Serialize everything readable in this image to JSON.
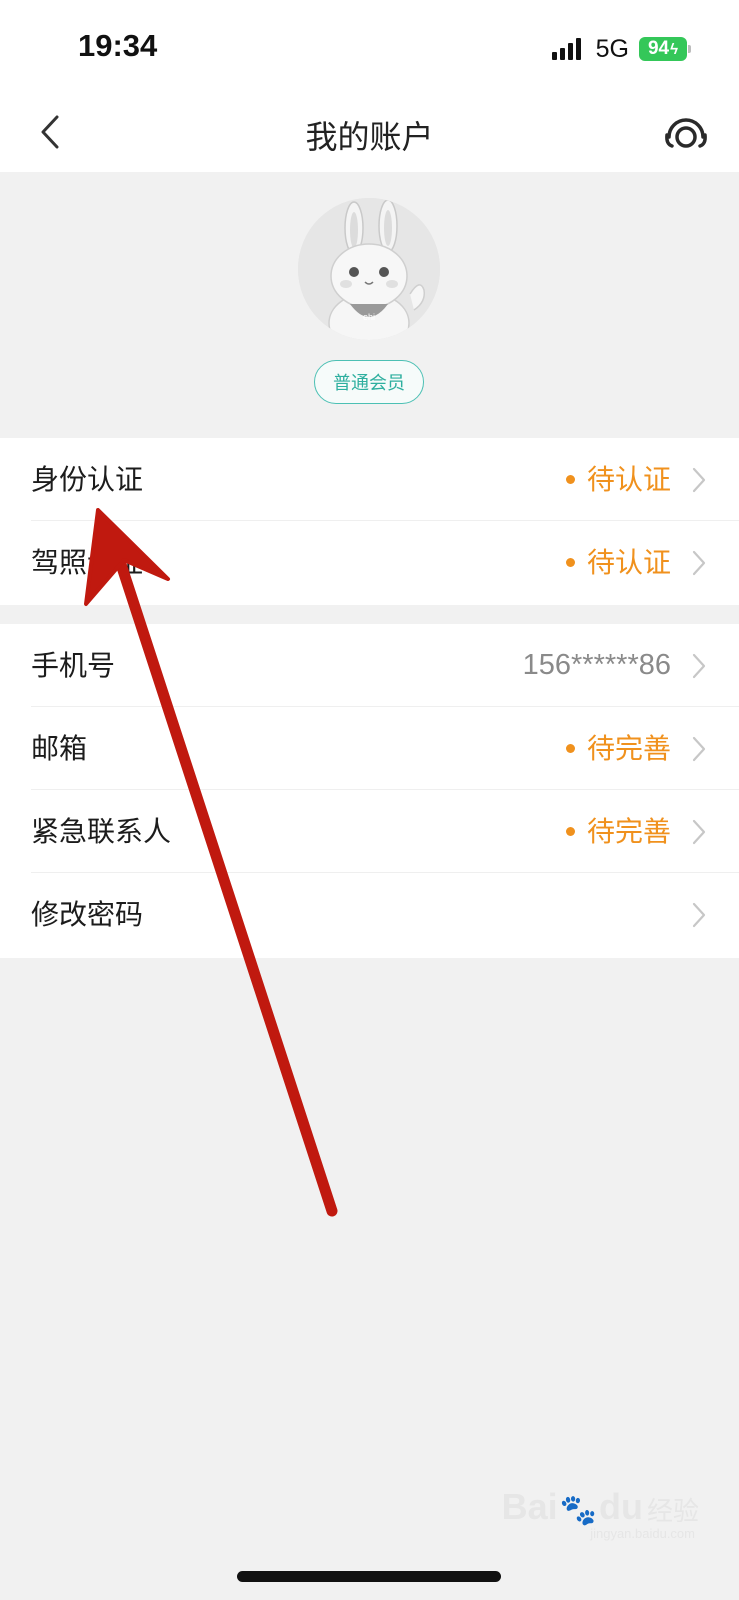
{
  "status_bar": {
    "time": "19:34",
    "network": "5G",
    "battery": "94"
  },
  "nav": {
    "title": "我的账户",
    "back_icon": "chevron-left-icon",
    "service_icon": "headset-icon"
  },
  "profile": {
    "avatar_text": "ehi",
    "member_level": "普通会员"
  },
  "verification": {
    "items": [
      {
        "label": "身份认证",
        "value": "待认证"
      },
      {
        "label": "驾照认证",
        "value": "待认证"
      }
    ]
  },
  "account": {
    "phone": {
      "label": "手机号",
      "value": "156******86"
    },
    "email": {
      "label": "邮箱",
      "value": "待完善"
    },
    "emergency": {
      "label": "紧急联系人",
      "value": "待完善"
    },
    "password": {
      "label": "修改密码"
    }
  },
  "colors": {
    "pending": "#f0911d",
    "member_badge": "#2eaf9f",
    "annotation_arrow": "#c0190f"
  },
  "watermark": {
    "brand_left": "Bai",
    "brand_right": "du",
    "brand_cn": "经验",
    "url": "jingyan.baidu.com"
  }
}
